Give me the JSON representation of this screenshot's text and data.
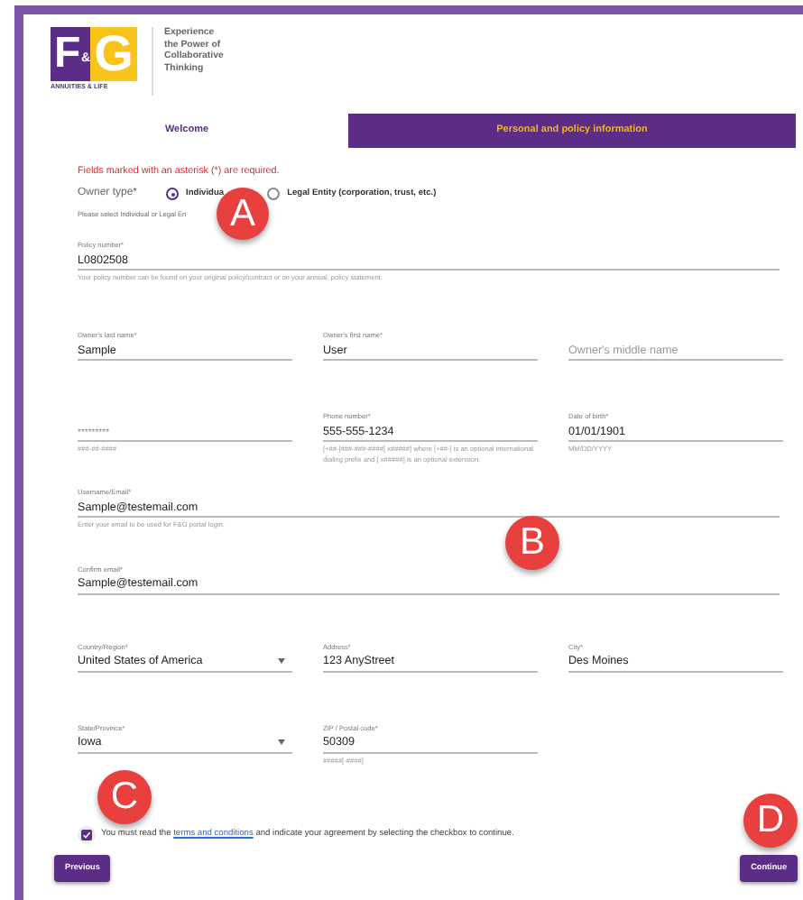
{
  "header": {
    "logo": {
      "letters": [
        "F",
        "&",
        "G"
      ],
      "subtitle": "ANNUITIES & LIFE"
    },
    "tagline": [
      "Experience",
      "the Power of",
      "Collaborative",
      "Thinking"
    ]
  },
  "tabs": [
    {
      "label": "Welcome",
      "selected": false
    },
    {
      "label": "Personal and policy information",
      "selected": true
    }
  ],
  "required_note": "Fields marked with an asterisk (*) are required.",
  "owner_type": {
    "label": "Owner type*",
    "options": [
      {
        "label": "Individua",
        "selected": true
      },
      {
        "label": "Legal Entity (corporation, trust, etc.)",
        "selected": false
      }
    ],
    "hint": "Please select Individual or Legal En"
  },
  "field_rows": [
    {
      "fields": [
        {
          "kind": "text",
          "label": "Policy number*",
          "value": "L0802508",
          "hint": "Your policy number can be found on your original policy/contract or on your annual, policy statement."
        }
      ]
    },
    {
      "fields": [
        {
          "kind": "text",
          "label": "Owner's last name*",
          "value": "Sample"
        },
        {
          "kind": "text",
          "label": "Owner's first name*",
          "value": "User"
        },
        {
          "kind": "text",
          "placeholder": "Owner's middle name"
        }
      ]
    },
    {
      "fields": [
        {
          "kind": "masked",
          "placeholder": "*********",
          "hint": "###-##-####"
        },
        {
          "kind": "text",
          "label": "Phone number*",
          "value": "555-555-1234",
          "hint": "[+##-]###-###-####[ x#####] where [+##-] is an optional international dialing prefix and [ x#####] is an optional extension."
        },
        {
          "kind": "text",
          "label": "Date of birth*",
          "value": "01/01/1901",
          "hint": "MM/DD/YYYY"
        }
      ]
    },
    {
      "fields": [
        {
          "kind": "text",
          "label": "Username/Email*",
          "value": "Sample@testemail.com",
          "hint": "Enter your email to be used for F&G portal login."
        }
      ]
    },
    {
      "fields": [
        {
          "kind": "text",
          "label": "Confirm email*",
          "value": "Sample@testemail.com"
        }
      ]
    },
    {
      "fields": [
        {
          "kind": "select",
          "label": "Country/Region*",
          "value": "United States of America"
        },
        {
          "kind": "text",
          "label": "Address*",
          "value": "123 AnyStreet"
        },
        {
          "kind": "text",
          "label": "City*",
          "value": "Des Moines"
        }
      ]
    },
    {
      "fields": [
        {
          "kind": "select",
          "label": "State/Province*",
          "value": "Iowa"
        },
        {
          "kind": "text",
          "label": "ZIP / Postal code*",
          "value": "50309",
          "hint": "#####[-####]"
        }
      ]
    }
  ],
  "agreement": {
    "checked": true,
    "before": "You must read the ",
    "link": "terms and conditions",
    "after": " and indicate your agreement by selecting the checkbox to continue."
  },
  "buttons": [
    {
      "label": "Previous"
    },
    {
      "label": "Continue"
    }
  ],
  "markers": [
    {
      "label": "A"
    },
    {
      "label": "B"
    },
    {
      "label": "C"
    },
    {
      "label": "D"
    }
  ]
}
